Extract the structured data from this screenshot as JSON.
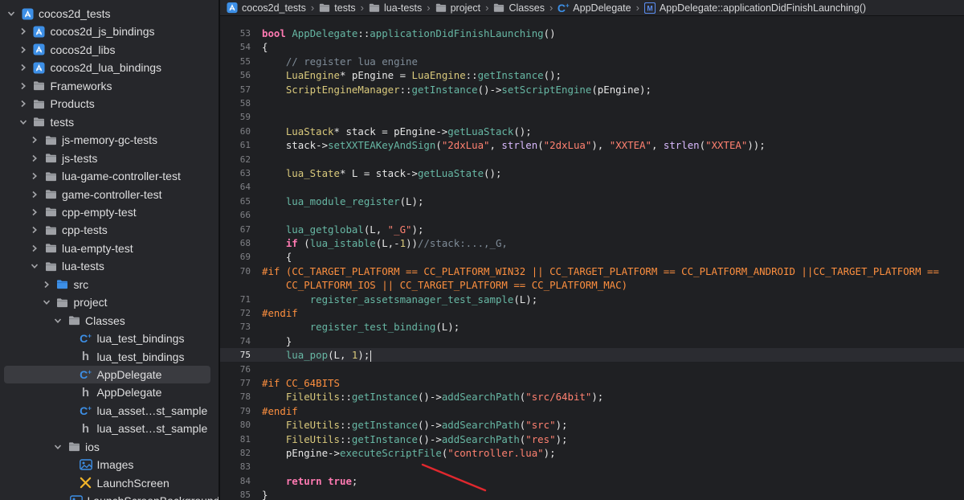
{
  "sidebar": {
    "items": [
      {
        "label": "cocos2d_tests",
        "depth": 0,
        "chevron": "down",
        "icon": "project"
      },
      {
        "label": "cocos2d_js_bindings",
        "depth": 1,
        "chevron": "right",
        "icon": "project"
      },
      {
        "label": "cocos2d_libs",
        "depth": 1,
        "chevron": "right",
        "icon": "project"
      },
      {
        "label": "cocos2d_lua_bindings",
        "depth": 1,
        "chevron": "right",
        "icon": "project"
      },
      {
        "label": "Frameworks",
        "depth": 1,
        "chevron": "right",
        "icon": "folder"
      },
      {
        "label": "Products",
        "depth": 1,
        "chevron": "right",
        "icon": "folder"
      },
      {
        "label": "tests",
        "depth": 1,
        "chevron": "down",
        "icon": "folder"
      },
      {
        "label": "js-memory-gc-tests",
        "depth": 2,
        "chevron": "right",
        "icon": "folder"
      },
      {
        "label": "js-tests",
        "depth": 2,
        "chevron": "right",
        "icon": "folder"
      },
      {
        "label": "lua-game-controller-test",
        "depth": 2,
        "chevron": "right",
        "icon": "folder"
      },
      {
        "label": "game-controller-test",
        "depth": 2,
        "chevron": "right",
        "icon": "folder"
      },
      {
        "label": "cpp-empty-test",
        "depth": 2,
        "chevron": "right",
        "icon": "folder"
      },
      {
        "label": "cpp-tests",
        "depth": 2,
        "chevron": "right",
        "icon": "folder"
      },
      {
        "label": "lua-empty-test",
        "depth": 2,
        "chevron": "right",
        "icon": "folder"
      },
      {
        "label": "lua-tests",
        "depth": 2,
        "chevron": "down",
        "icon": "folder"
      },
      {
        "label": "src",
        "depth": 3,
        "chevron": "right",
        "icon": "folder-blue"
      },
      {
        "label": "project",
        "depth": 3,
        "chevron": "down",
        "icon": "folder"
      },
      {
        "label": "Classes",
        "depth": 4,
        "chevron": "down",
        "icon": "folder"
      },
      {
        "label": "lua_test_bindings",
        "depth": 5,
        "chevron": "",
        "icon": "cpp"
      },
      {
        "label": "lua_test_bindings",
        "depth": 5,
        "chevron": "",
        "icon": "h"
      },
      {
        "label": "AppDelegate",
        "depth": 5,
        "chevron": "",
        "icon": "cpp",
        "selected": true
      },
      {
        "label": "AppDelegate",
        "depth": 5,
        "chevron": "",
        "icon": "h"
      },
      {
        "label": "lua_asset…st_sample",
        "depth": 5,
        "chevron": "",
        "icon": "cpp"
      },
      {
        "label": "lua_asset…st_sample",
        "depth": 5,
        "chevron": "",
        "icon": "h"
      },
      {
        "label": "ios",
        "depth": 4,
        "chevron": "down",
        "icon": "folder"
      },
      {
        "label": "Images",
        "depth": 5,
        "chevron": "",
        "icon": "images"
      },
      {
        "label": "LaunchScreen",
        "depth": 5,
        "chevron": "",
        "icon": "xib"
      },
      {
        "label": "LaunchScreenBackground",
        "depth": 5,
        "chevron": "",
        "icon": "images"
      }
    ]
  },
  "breadcrumb": [
    {
      "label": "cocos2d_tests",
      "icon": "project"
    },
    {
      "label": "tests",
      "icon": "folder"
    },
    {
      "label": "lua-tests",
      "icon": "folder"
    },
    {
      "label": "project",
      "icon": "folder"
    },
    {
      "label": "Classes",
      "icon": "folder"
    },
    {
      "label": "AppDelegate",
      "icon": "cpp"
    },
    {
      "label": "AppDelegate::applicationDidFinishLaunching()",
      "icon": "method"
    }
  ],
  "editor": {
    "current_line": "75",
    "lines": [
      {
        "n": "53",
        "html": "<span class='kw'>bool</span> <span class='fn'>AppDelegate</span>::<span class='fn'>applicationDidFinishLaunching</span>()"
      },
      {
        "n": "54",
        "html": "{"
      },
      {
        "n": "55",
        "html": "    <span class='cm'>// register lua engine</span>"
      },
      {
        "n": "56",
        "html": "    <span class='ty'>LuaEngine</span>* pEngine = <span class='ty'>LuaEngine</span>::<span class='fn'>getInstance</span>();"
      },
      {
        "n": "57",
        "html": "    <span class='ty'>ScriptEngineManager</span>::<span class='fn'>getInstance</span>()-><span class='fn'>setScriptEngine</span>(pEngine);"
      },
      {
        "n": "58",
        "html": ""
      },
      {
        "n": "59",
        "html": ""
      },
      {
        "n": "60",
        "html": "    <span class='ty'>LuaStack</span>* stack = pEngine-><span class='fn'>getLuaStack</span>();"
      },
      {
        "n": "61",
        "html": "    stack-><span class='fn'>setXXTEAKeyAndSign</span>(<span class='str'>\"2dxLua\"</span>, <span class='kw' style='font-weight:normal;color:#dabaff'>strlen</span>(<span class='str'>\"2dxLua\"</span>), <span class='str'>\"XXTEA\"</span>, <span class='kw' style='font-weight:normal;color:#dabaff'>strlen</span>(<span class='str'>\"XXTEA\"</span>));"
      },
      {
        "n": "62",
        "html": ""
      },
      {
        "n": "63",
        "html": "    <span class='ty'>lua_State</span>* L = stack-><span class='fn'>getLuaState</span>();"
      },
      {
        "n": "64",
        "html": ""
      },
      {
        "n": "65",
        "html": "    <span class='fn'>lua_module_register</span>(L);"
      },
      {
        "n": "66",
        "html": ""
      },
      {
        "n": "67",
        "html": "    <span class='fn'>lua_getglobal</span>(L, <span class='str'>\"_G\"</span>);"
      },
      {
        "n": "68",
        "html": "    <span class='kw'>if</span> (<span class='fn'>lua_istable</span>(L,-<span class='num'>1</span>))<span class='cm'>//stack:...,_G,</span>"
      },
      {
        "n": "69",
        "html": "    {"
      },
      {
        "n": "70",
        "html": "<span class='pp'>#if (CC_TARGET_PLATFORM == CC_PLATFORM_WIN32 || CC_TARGET_PLATFORM == CC_PLATFORM_ANDROID ||CC_TARGET_PLATFORM ==</span>"
      },
      {
        "n": "",
        "html": "    <span class='pp'>CC_PLATFORM_IOS || CC_TARGET_PLATFORM == CC_PLATFORM_MAC)</span>"
      },
      {
        "n": "71",
        "html": "        <span class='fn'>register_assetsmanager_test_sample</span>(L);"
      },
      {
        "n": "72",
        "html": "<span class='pp'>#endif</span>"
      },
      {
        "n": "73",
        "html": "        <span class='fn'>register_test_binding</span>(L);"
      },
      {
        "n": "74",
        "html": "    }"
      },
      {
        "n": "75",
        "html": "    <span class='fn'>lua_pop</span>(L, <span class='num'>1</span>);"
      },
      {
        "n": "76",
        "html": ""
      },
      {
        "n": "77",
        "html": "<span class='pp'>#if CC_64BITS</span>"
      },
      {
        "n": "78",
        "html": "    <span class='ty'>FileUtils</span>::<span class='fn'>getInstance</span>()-><span class='fn'>addSearchPath</span>(<span class='str'>\"src/64bit\"</span>);"
      },
      {
        "n": "79",
        "html": "<span class='pp'>#endif</span>"
      },
      {
        "n": "80",
        "html": "    <span class='ty'>FileUtils</span>::<span class='fn'>getInstance</span>()-><span class='fn'>addSearchPath</span>(<span class='str'>\"src\"</span>);"
      },
      {
        "n": "81",
        "html": "    <span class='ty'>FileUtils</span>::<span class='fn'>getInstance</span>()-><span class='fn'>addSearchPath</span>(<span class='str'>\"res\"</span>);"
      },
      {
        "n": "82",
        "html": "    pEngine-><span class='fn'>executeScriptFile</span>(<span class='str'>\"controller.lua\"</span>);"
      },
      {
        "n": "83",
        "html": ""
      },
      {
        "n": "84",
        "html": "    <span class='kw'>return</span> <span class='kw'>true</span>;"
      },
      {
        "n": "85",
        "html": "}"
      }
    ]
  },
  "colors": {
    "sidebar_bg": "#26272b",
    "editor_bg": "#1f2023",
    "annotation_arrow": "#e0282e",
    "blue_icon": "#3d8fe6",
    "folder_grey": "#9fa1a6"
  }
}
